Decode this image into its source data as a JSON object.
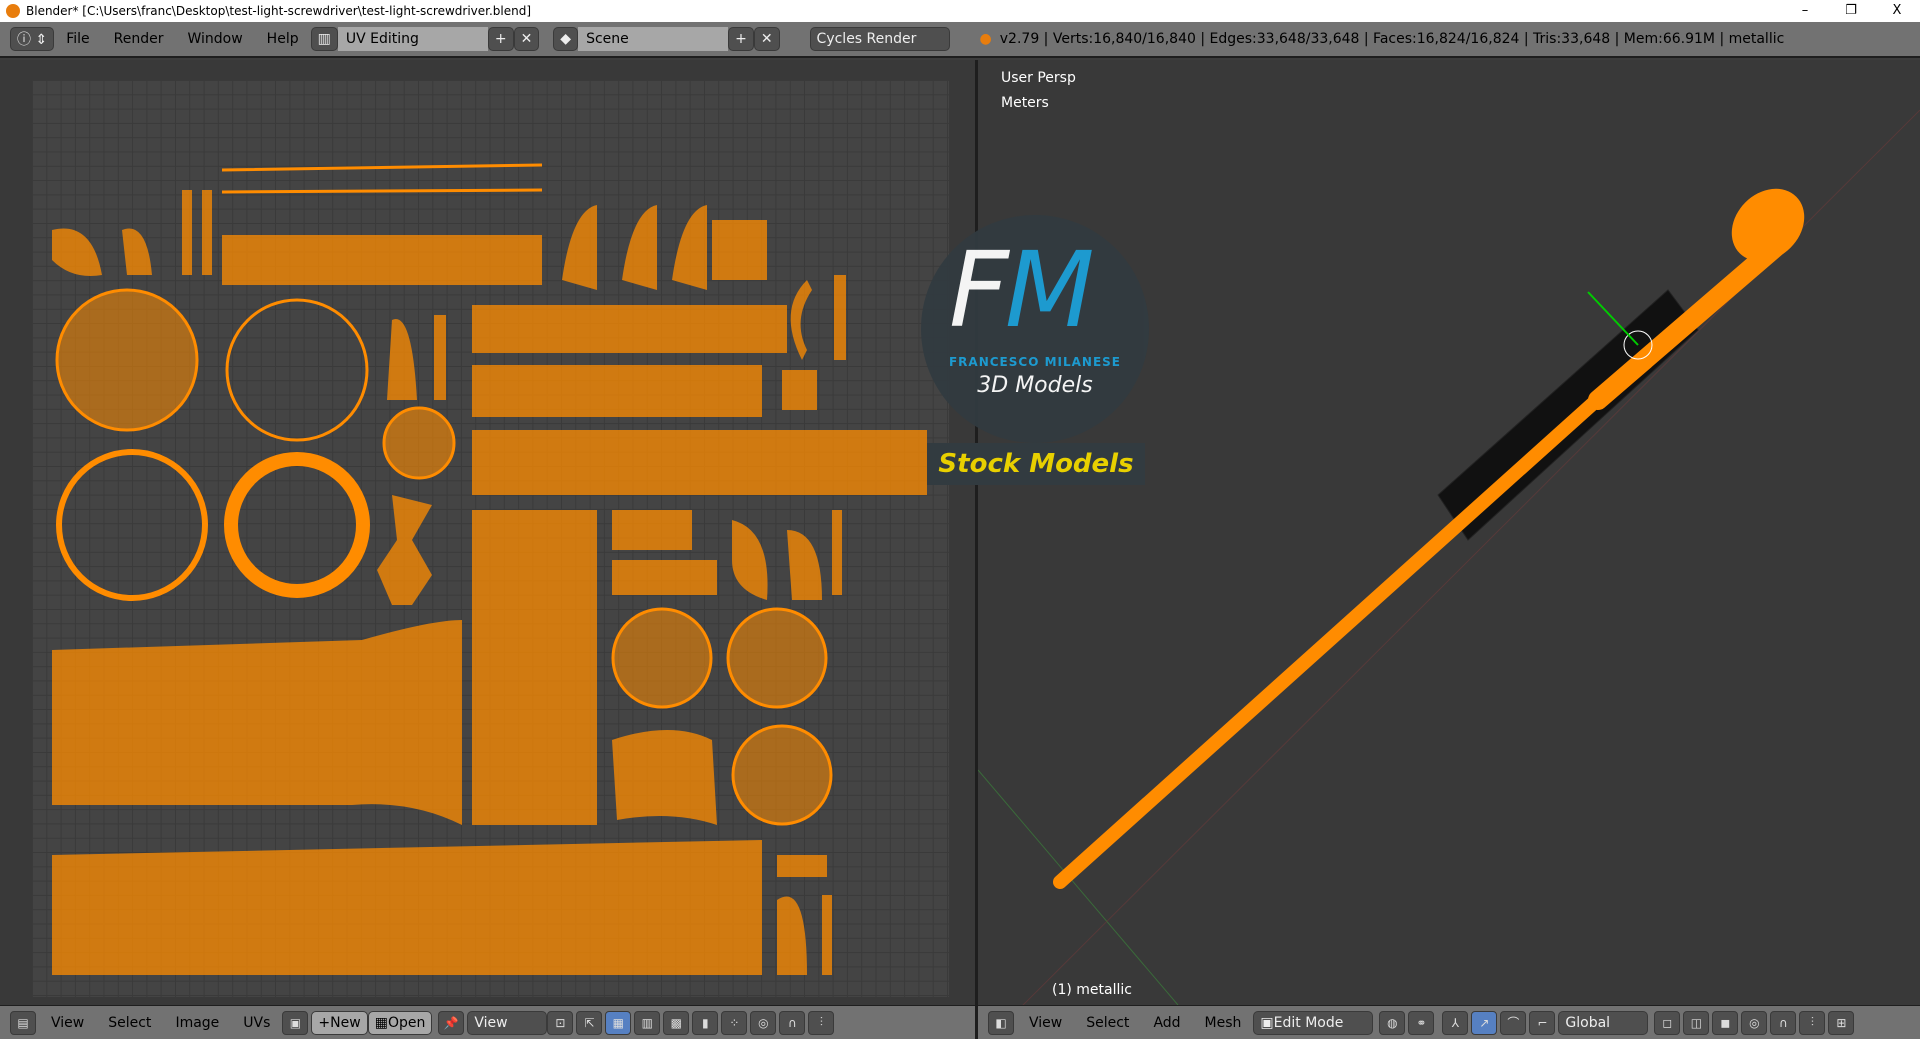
{
  "window": {
    "title": "Blender* [C:\\Users\\franc\\Desktop\\test-light-screwdriver\\test-light-screwdriver.blend]",
    "minimize": "–",
    "restore": "❐",
    "close": "X"
  },
  "topbar": {
    "menus": [
      "File",
      "Render",
      "Window",
      "Help"
    ],
    "layout": "UV Editing",
    "scene": "Scene",
    "engine": "Cycles Render",
    "stats": "v2.79 | Verts:16,840/16,840 | Edges:33,648/33,648 | Faces:16,824/16,824 | Tris:33,648 | Mem:66.91M | metallic"
  },
  "viewport": {
    "view_name": "User Persp",
    "units": "Meters",
    "object_label": "(1) metallic"
  },
  "watermark": {
    "logo": "FM",
    "name": "FRANCESCO MILANESE",
    "sub": "3D Models",
    "stock": "Stock Models"
  },
  "uv_footer": {
    "menus": [
      "View",
      "Select",
      "Image",
      "UVs"
    ],
    "new": "New",
    "open": "Open",
    "view": "View"
  },
  "view3d_footer": {
    "menus": [
      "View",
      "Select",
      "Add",
      "Mesh"
    ],
    "mode": "Edit Mode",
    "orientation": "Global"
  },
  "colors": {
    "accent": "#ff8c00",
    "header": "#727272",
    "background": "#393939"
  }
}
